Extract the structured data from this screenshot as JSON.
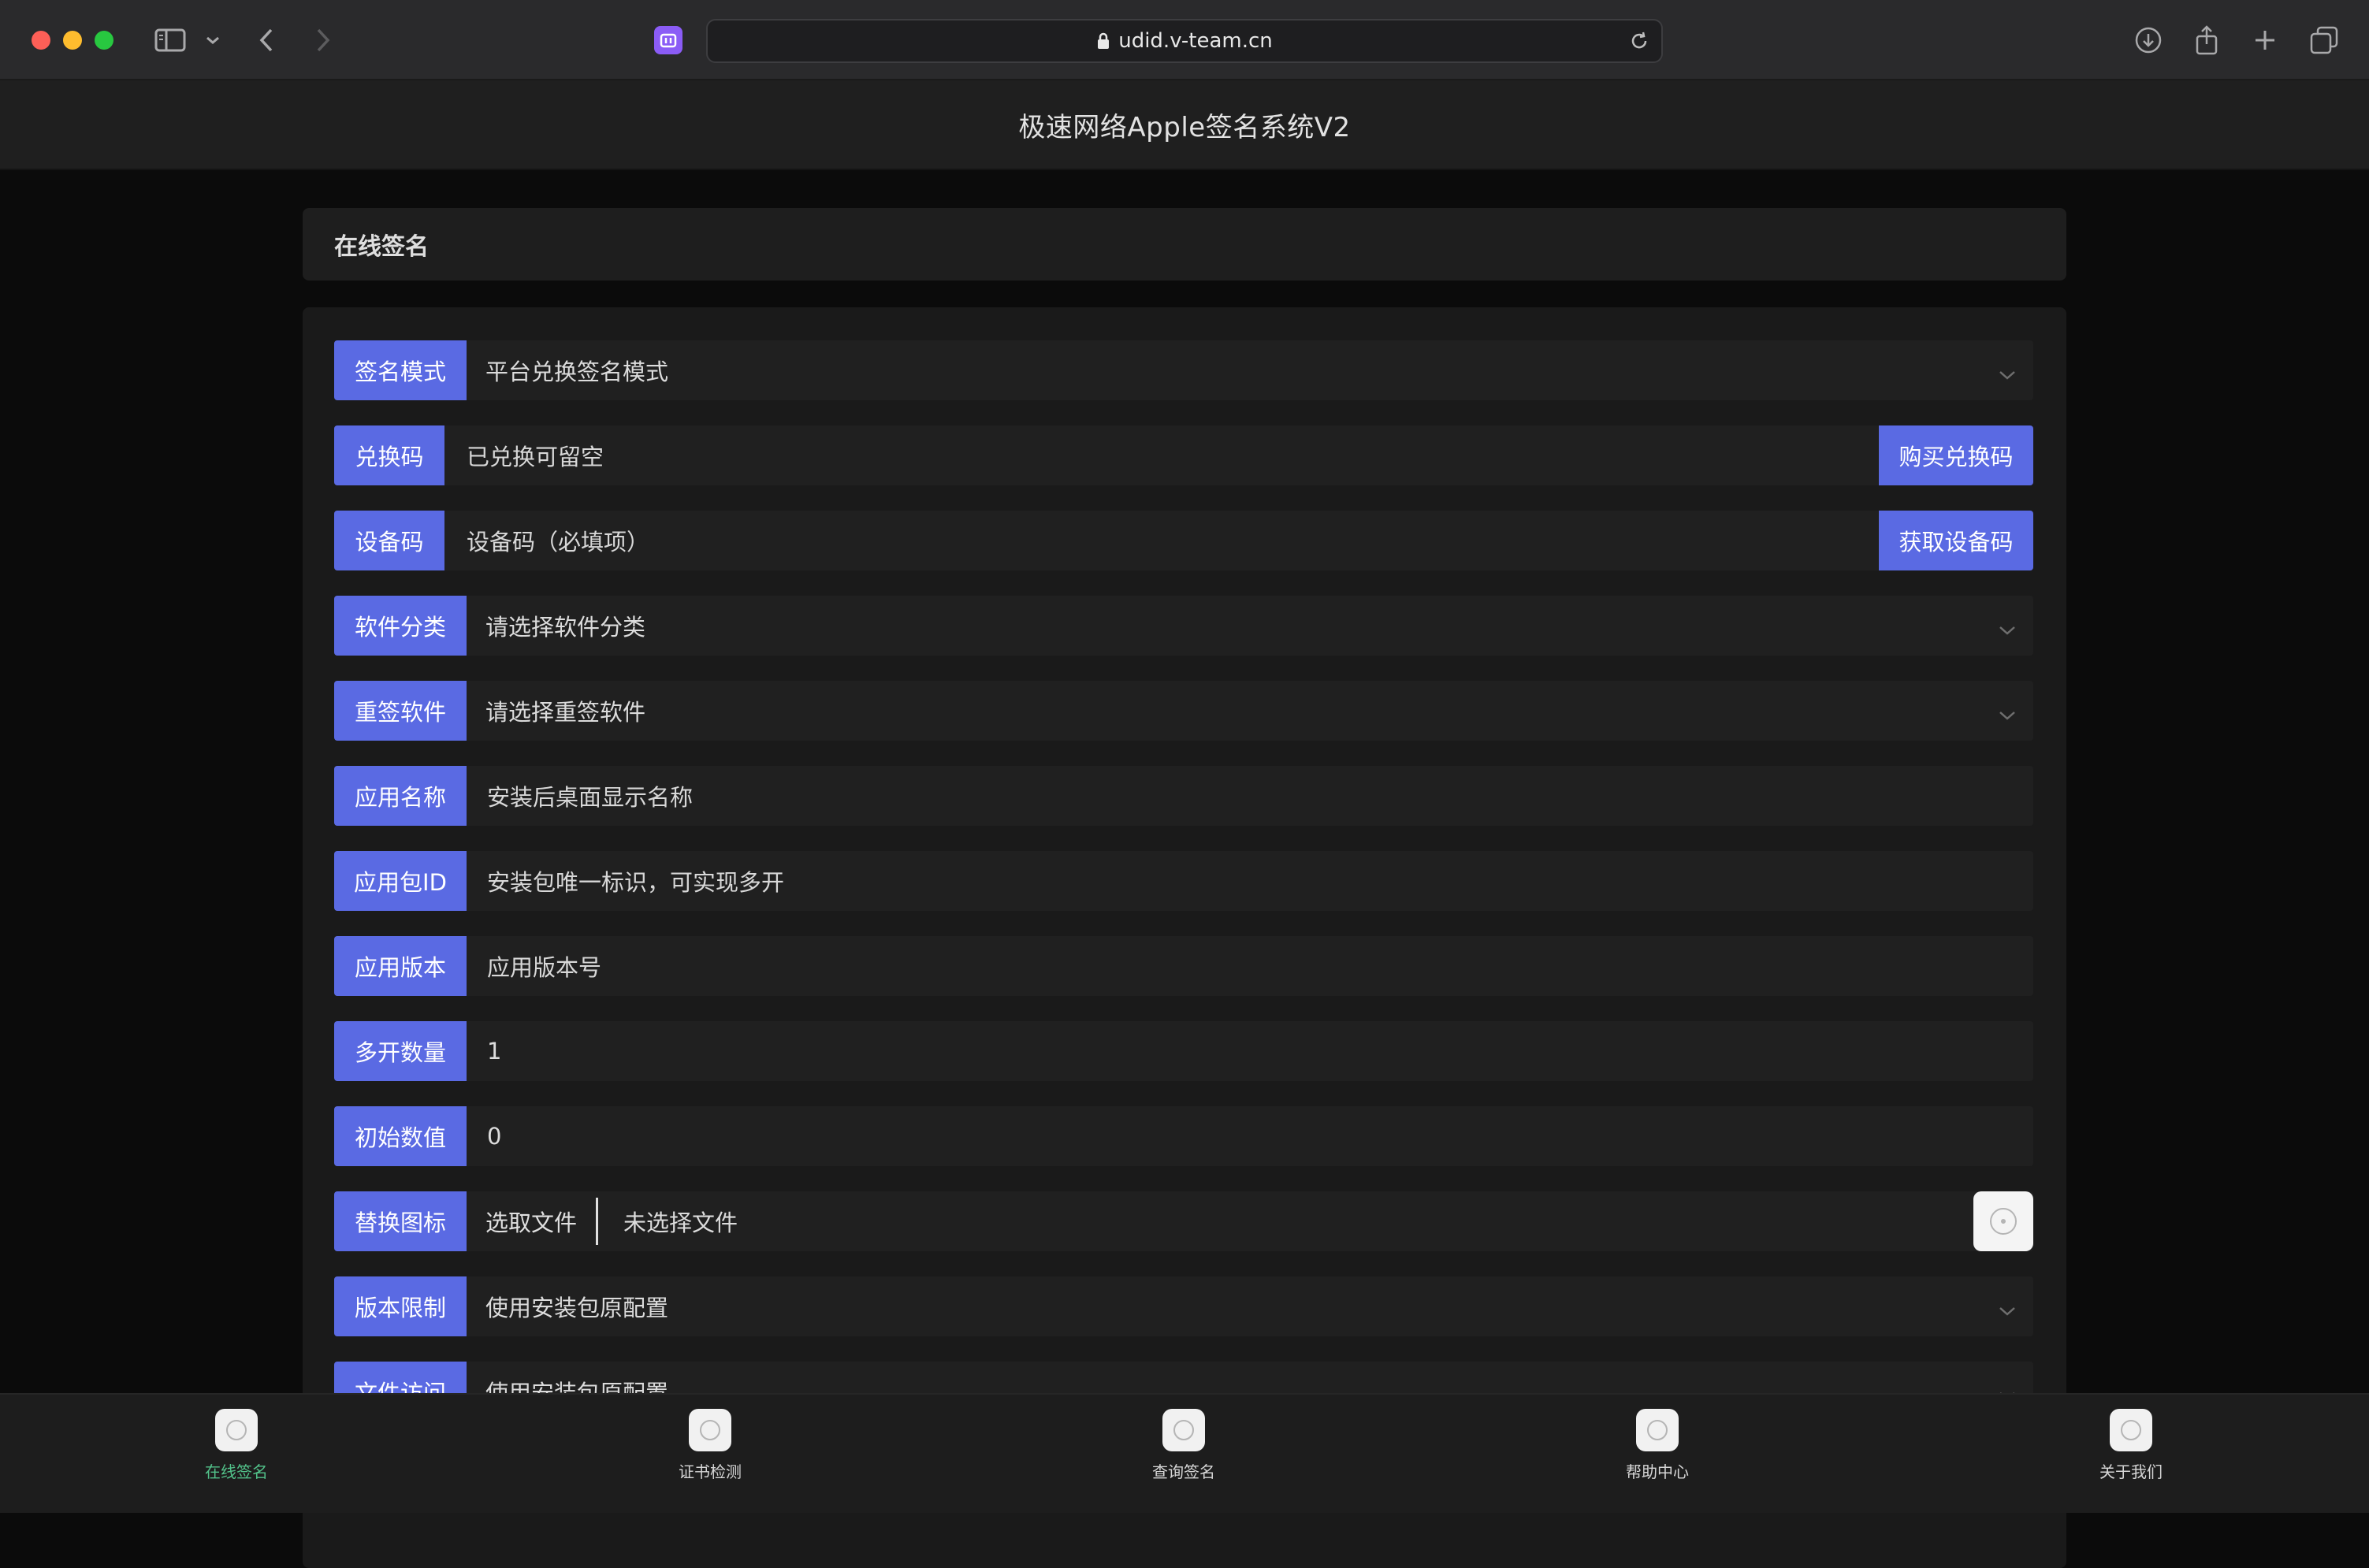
{
  "browser": {
    "url": "udid.v-team.cn"
  },
  "site": {
    "title": "极速网络Apple签名系统V2"
  },
  "panel": {
    "title": "在线签名"
  },
  "form": {
    "sign_mode": {
      "label": "签名模式",
      "value": "平台兑换签名模式"
    },
    "redeem_code": {
      "label": "兑换码",
      "placeholder": "已兑换可留空",
      "button": "购买兑换码"
    },
    "device_code": {
      "label": "设备码",
      "placeholder": "设备码（必填项）",
      "button": "获取设备码"
    },
    "app_category": {
      "label": "软件分类",
      "value": "请选择软件分类"
    },
    "resign_app": {
      "label": "重签软件",
      "value": "请选择重签软件"
    },
    "app_name": {
      "label": "应用名称",
      "placeholder": "安装后桌面显示名称"
    },
    "bundle_id": {
      "label": "应用包ID",
      "placeholder": "安装包唯一标识，可实现多开"
    },
    "app_version": {
      "label": "应用版本",
      "placeholder": "应用版本号"
    },
    "multi_count": {
      "label": "多开数量",
      "value": "1"
    },
    "initial_value": {
      "label": "初始数值",
      "value": "0"
    },
    "replace_icon": {
      "label": "替换图标",
      "choose": "选取文件",
      "status": "未选择文件"
    },
    "version_limit": {
      "label": "版本限制",
      "value": "使用安装包原配置"
    },
    "file_access": {
      "label": "文件访问",
      "value": "使用安装包原配置"
    }
  },
  "tabs": [
    {
      "label": "在线签名",
      "active": true
    },
    {
      "label": "证书检测",
      "active": false
    },
    {
      "label": "查询签名",
      "active": false
    },
    {
      "label": "帮助中心",
      "active": false
    },
    {
      "label": "关于我们",
      "active": false
    }
  ],
  "colors": {
    "accent": "#5a6ae3",
    "active_tab": "#52c28a"
  }
}
